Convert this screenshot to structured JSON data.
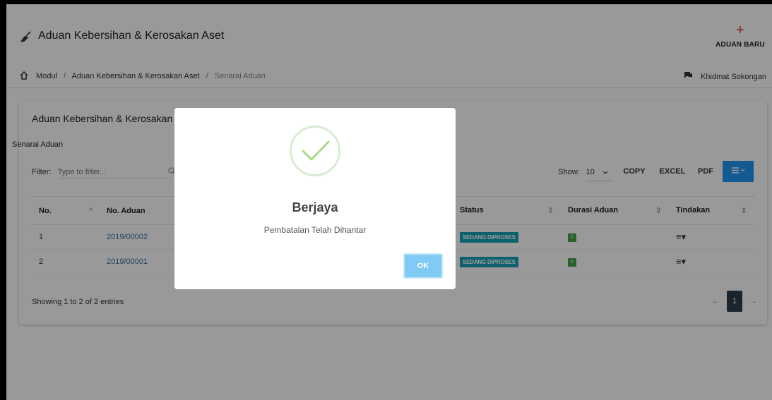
{
  "header": {
    "title": "Aduan Kebersihan & Kerosakan Aset",
    "new_button_label": "ADUAN BARU"
  },
  "breadcrumb": {
    "items": [
      "Modul",
      "Aduan Kebersihan & Kerosakan Aset",
      "Senarai Aduan"
    ],
    "separator": "/",
    "support_label": "Khidmat Sokongan"
  },
  "panel": {
    "title": "Aduan Kebersihan & Kerosakan Aset",
    "subtitle": "Senarai Aduan",
    "filter_label": "Filter:",
    "filter_placeholder": "Type to filter...",
    "show_label": "Show:",
    "show_value": "10",
    "buttons": {
      "copy": "COPY",
      "excel": "EXCEL",
      "pdf": "PDF"
    }
  },
  "table": {
    "columns": [
      "No.",
      "No. Aduan",
      "Status",
      "Durasi Aduan",
      "Tindakan"
    ],
    "rows": [
      {
        "no": "1",
        "aduan": "2019/00002",
        "status": "SEDANG DIPROSES",
        "durasi": "0"
      },
      {
        "no": "2",
        "aduan": "2019/00001",
        "status": "SEDANG DIPROSES",
        "durasi": "0"
      }
    ]
  },
  "footer": {
    "info": "Showing 1 to 2 of 2 entries",
    "current_page": "1",
    "prev": "←",
    "next": "→"
  },
  "modal": {
    "title": "Berjaya",
    "message": "Pembatalan Telah Dihantar",
    "ok_label": "OK"
  },
  "colors": {
    "accent_blue": "#2196f3",
    "status_teal": "#17a2b8",
    "success_green": "#43a047",
    "plus_red": "#d9363e"
  },
  "icons": {
    "title": "broom-icon",
    "home": "home-icon",
    "support": "chat-icon",
    "search": "search-icon",
    "menu": "hamburger-icon",
    "actions": "hamburger-icon",
    "success": "checkmark-icon"
  }
}
